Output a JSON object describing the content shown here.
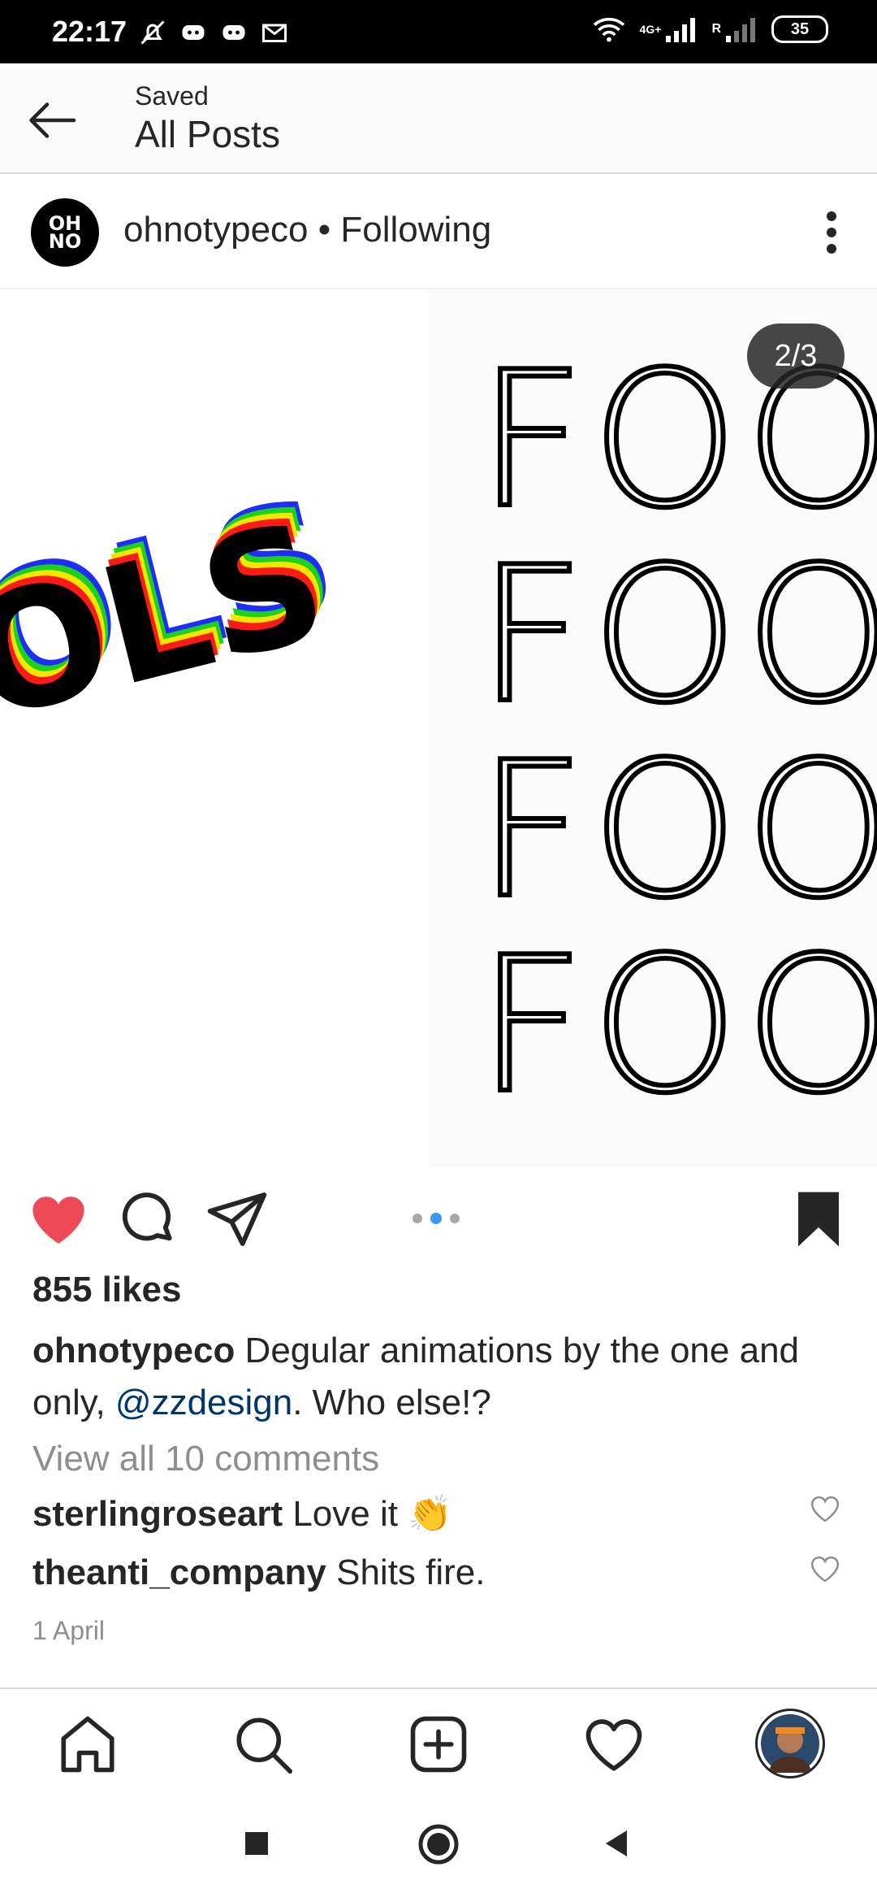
{
  "status_bar": {
    "time": "22:17",
    "battery": "35",
    "network_label": "4G+",
    "roaming_label": "R",
    "icons_left": [
      "mute-bell-icon",
      "discord-icon",
      "discord-icon",
      "gmail-icon"
    ],
    "icons_right": [
      "wifi-icon",
      "signal-icon",
      "signal-icon",
      "battery-icon"
    ]
  },
  "header": {
    "subtitle": "Saved",
    "title": "All Posts"
  },
  "post": {
    "username": "ohnotypeco",
    "following_label": " • Following",
    "avatar_text": "OH NO",
    "carousel_counter": "2/3",
    "image_left_text": "OLS",
    "image_right_lines": [
      "FOO",
      "FOO",
      "FOO",
      "FOO"
    ],
    "likes": "855 likes",
    "caption_user": "ohnotypeco",
    "caption_text_1": " Degular animations by the one and only, ",
    "caption_mention": "@zzdesign",
    "caption_text_2": ". Who else!?",
    "view_comments": "View all 10 comments",
    "comments": [
      {
        "user": "sterlingroseart",
        "text": " Love it 👏"
      },
      {
        "user": "theanti_company",
        "text": " Shits fire."
      }
    ],
    "date": "1 April"
  },
  "colors": {
    "like_red": "#ed4956",
    "mention_blue": "#003569",
    "dot_active": "#3897f0",
    "muted_text": "#8e8e8e"
  }
}
